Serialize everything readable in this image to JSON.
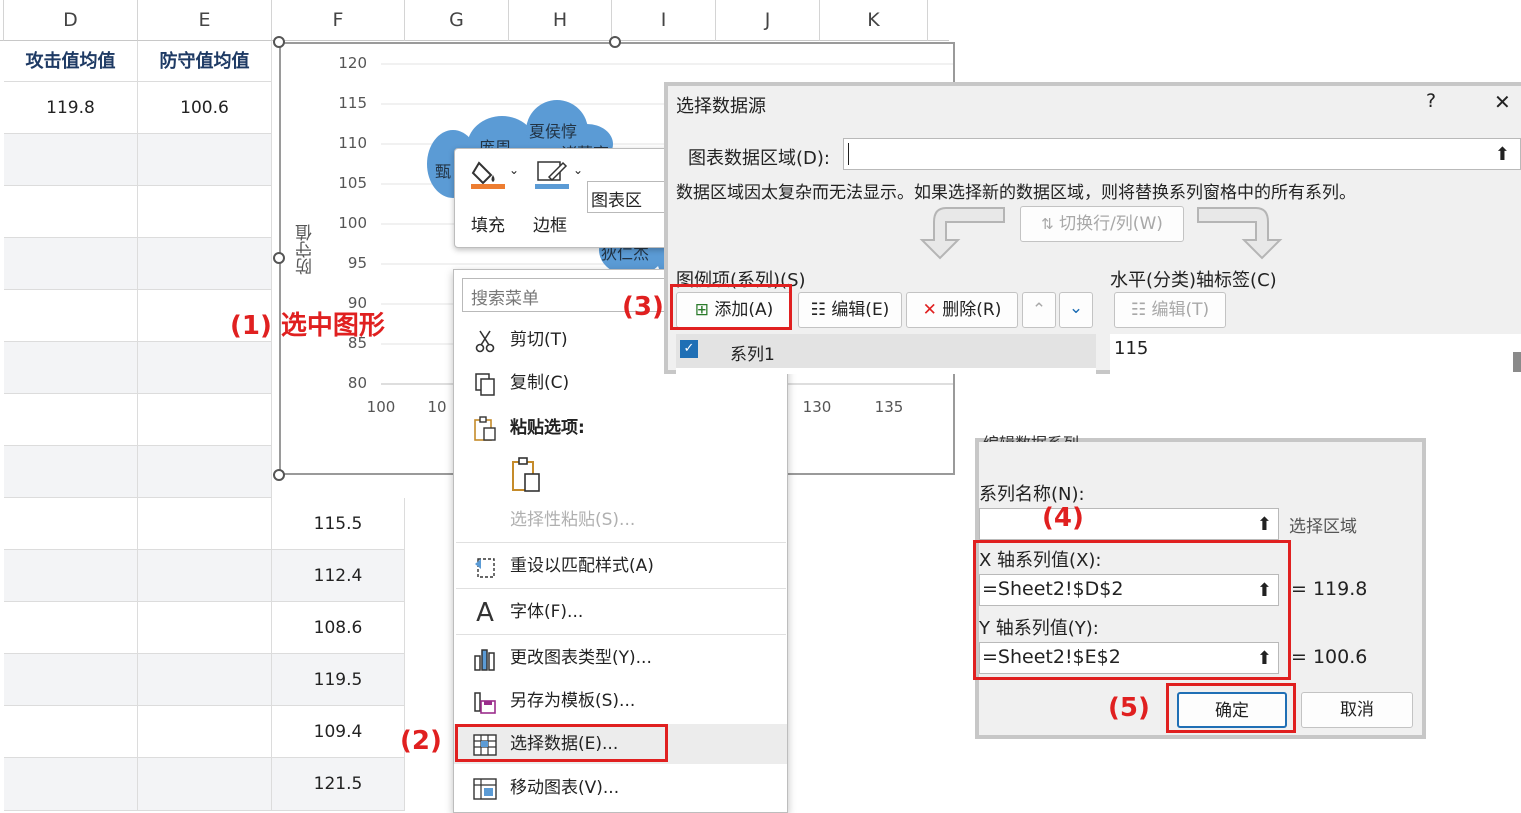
{
  "spreadsheet": {
    "columns": [
      "D",
      "E",
      "F",
      "G",
      "H",
      "I",
      "J",
      "K"
    ],
    "header_row": {
      "d": "攻击值均值",
      "e": "防守值均值"
    },
    "first_row": {
      "d": "119.8",
      "e": "100.6"
    },
    "f_values": [
      "115.5",
      "112.4",
      "108.6",
      "119.5",
      "109.4",
      "121.5"
    ]
  },
  "chart": {
    "y_axis_title": "防守值",
    "x_ticks": [
      "100",
      "10",
      "130",
      "135"
    ],
    "bubble_labels": [
      "庞周",
      "夏侯惇",
      "诸葛亮",
      "甄",
      "狄仁杰"
    ],
    "chart_area_label": "图表区"
  },
  "chart_data": {
    "type": "scatter",
    "ylabel": "防守值",
    "y_ticks": [
      "120",
      "115",
      "110",
      "105",
      "100",
      "95",
      "90",
      "85",
      "80"
    ],
    "ylim": [
      80,
      120
    ],
    "x_ticks_visible": [
      "100",
      "130",
      "135"
    ],
    "points": [
      {
        "label": "甄",
        "x": 103,
        "y": 107
      },
      {
        "label": "庞周",
        "x": 106,
        "y": 110
      },
      {
        "label": "夏侯惇",
        "x": 110,
        "y": 113
      },
      {
        "label": "诸葛亮",
        "x": 112,
        "y": 110
      },
      {
        "label": "狄仁杰",
        "x": 115,
        "y": 95
      }
    ]
  },
  "format_toolbar": {
    "fill": "填充",
    "border": "边框"
  },
  "context_menu": {
    "search_placeholder": "搜索菜单",
    "cut": "剪切(T)",
    "copy": "复制(C)",
    "paste_options": "粘贴选项:",
    "paste_special": "选择性粘贴(S)...",
    "reset_style": "重设以匹配样式(A)",
    "font": "字体(F)...",
    "change_type": "更改图表类型(Y)...",
    "save_template": "另存为模板(S)...",
    "select_data": "选择数据(E)...",
    "move_chart": "移动图表(V)..."
  },
  "annotations": {
    "step1": "(1) 选中图形",
    "step2": "(2)",
    "step3": "(3)",
    "step4": "(4)",
    "step5": "(5)"
  },
  "select_data_dialog": {
    "title": "选择数据源",
    "help": "?",
    "close": "✕",
    "range_label": "图表数据区域(D):",
    "range_value": "",
    "notice": "数据区域因太复杂而无法显示。如果选择新的数据区域，则将替换系列窗格中的所有系列。",
    "switch": "切换行/列(W)",
    "legend_label": "图例项(系列)(S)",
    "axis_label": "水平(分类)轴标签(C)",
    "add": "添加(A)",
    "edit": "编辑(E)",
    "delete": "删除(R)",
    "axis_edit": "编辑(T)",
    "series1": "系列1",
    "axis_value": "115"
  },
  "edit_series_dialog": {
    "title": "编辑数据系列",
    "name_label": "系列名称(N):",
    "name_value": "",
    "select_range": "选择区域",
    "x_label": "X 轴系列值(X):",
    "x_value": "=Sheet2!$D$2",
    "x_result": "= 119.8",
    "y_label": "Y 轴系列值(Y):",
    "y_value": "=Sheet2!$E$2",
    "y_result": "= 100.6",
    "ok": "确定",
    "cancel": "取消"
  },
  "colors": {
    "accent_red": "#e02020",
    "bubble": "#5b9bd5",
    "fill_orange": "#ed7d31",
    "border_blue": "#5b9bd5"
  }
}
